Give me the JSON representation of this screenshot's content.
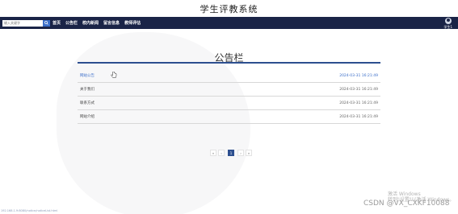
{
  "site": {
    "title": "学生评教系统"
  },
  "search": {
    "placeholder": "输入关键字"
  },
  "nav": {
    "links": [
      {
        "label": "首页"
      },
      {
        "label": "公告栏"
      },
      {
        "label": "校内新闻"
      },
      {
        "label": "留言信息"
      },
      {
        "label": "教师评估"
      }
    ]
  },
  "user": {
    "name": "学生1"
  },
  "panel": {
    "title": "公告栏"
  },
  "notices": [
    {
      "title": "网站公告",
      "time": "2024-03-31 16:21:49"
    },
    {
      "title": "关于我们",
      "time": "2024-03-31 16:21:49"
    },
    {
      "title": "联系方式",
      "time": "2024-03-31 16:21:49"
    },
    {
      "title": "网站介绍",
      "time": "2024-03-31 16:21:49"
    }
  ],
  "pager": {
    "first": "«",
    "prev": "‹",
    "current": "1",
    "next": "›",
    "last": "»"
  },
  "watermarks": {
    "windows_line1": "激活 Windows",
    "windows_line2": "转到\"设置\"以激活 Windows。",
    "csdn": "CSDN @VX_CXKF10088",
    "status_url": "192.168.1.9:8080/notice/noticeList.html"
  },
  "colors": {
    "navbar": "#1a2447",
    "accent": "#2d4f8f",
    "link_active": "#3b6ec9"
  }
}
